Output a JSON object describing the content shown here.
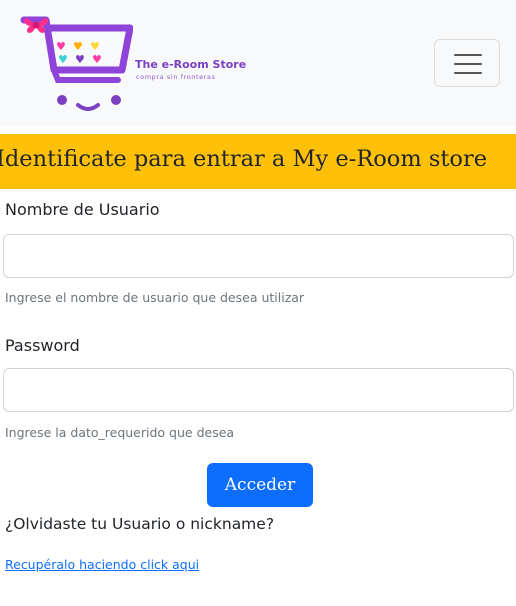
{
  "navbar": {
    "brand_name": "The e-Room Store",
    "brand_tagline": "compra sin fronteras",
    "toggler_icon": "menu-icon"
  },
  "banner": {
    "text": "Identificate para entrar a My e-Room store"
  },
  "form": {
    "username": {
      "label": "Nombre de Usuario",
      "value": "",
      "placeholder": "",
      "help": "Ingrese el nombre de usuario que desea utilizar"
    },
    "password": {
      "label": "Password",
      "value": "",
      "placeholder": "",
      "help": "Ingrese la dato_requerido que desea"
    },
    "submit_label": "Acceder"
  },
  "recovery": {
    "question": "¿Olvidaste tu Usuario o nickname?",
    "link_text": "Recupéralo haciendo click aqui"
  },
  "colors": {
    "navbar_bg": "#f8f9fa",
    "banner_bg": "#ffc107",
    "primary": "#0d6efd",
    "brand_purple": "#7b3fc1"
  }
}
